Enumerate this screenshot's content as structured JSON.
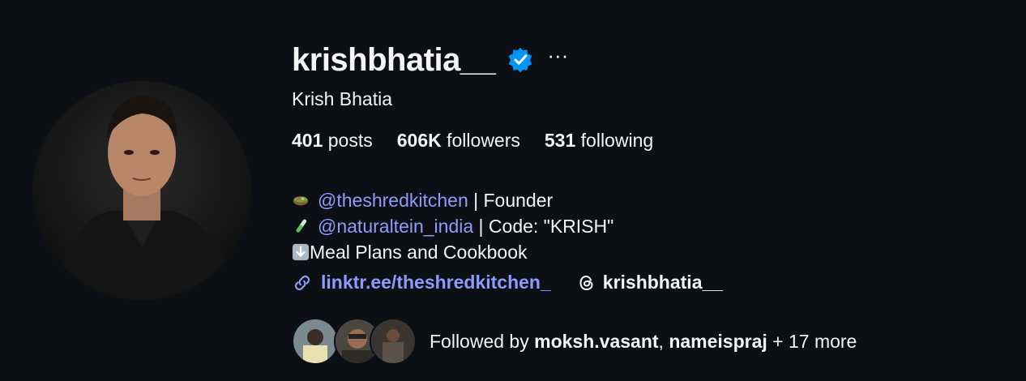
{
  "profile": {
    "username": "krishbhatia__",
    "full_name": "Krish Bhatia",
    "more_label": "···"
  },
  "stats": {
    "posts_count": "401",
    "posts_label": "posts",
    "followers_count": "606K",
    "followers_label": "followers",
    "following_count": "531",
    "following_label": "following"
  },
  "bio": {
    "line1_mention": "@theshredkitchen",
    "line1_rest": " | Founder",
    "line2_mention": "@naturaltein_india",
    "line2_rest": " | Code: \"KRISH\"",
    "line3_text": "Meal Plans and Cookbook"
  },
  "links": {
    "website": "linktr.ee/theshredkitchen_",
    "threads_handle": "krishbhatia__"
  },
  "followed_by": {
    "prefix": "Followed by ",
    "user1": "moksh.vasant",
    "separator": ", ",
    "user2": "nameispraj",
    "suffix": " + 17 more"
  },
  "colors": {
    "background": "#0c1014",
    "link": "#8d9bff",
    "verified": "#0095f6"
  },
  "icons": [
    "verified-badge-icon",
    "more-options-icon",
    "salad-bowl-emoji",
    "test-tube-emoji",
    "down-arrow-emoji",
    "link-icon",
    "threads-icon"
  ]
}
